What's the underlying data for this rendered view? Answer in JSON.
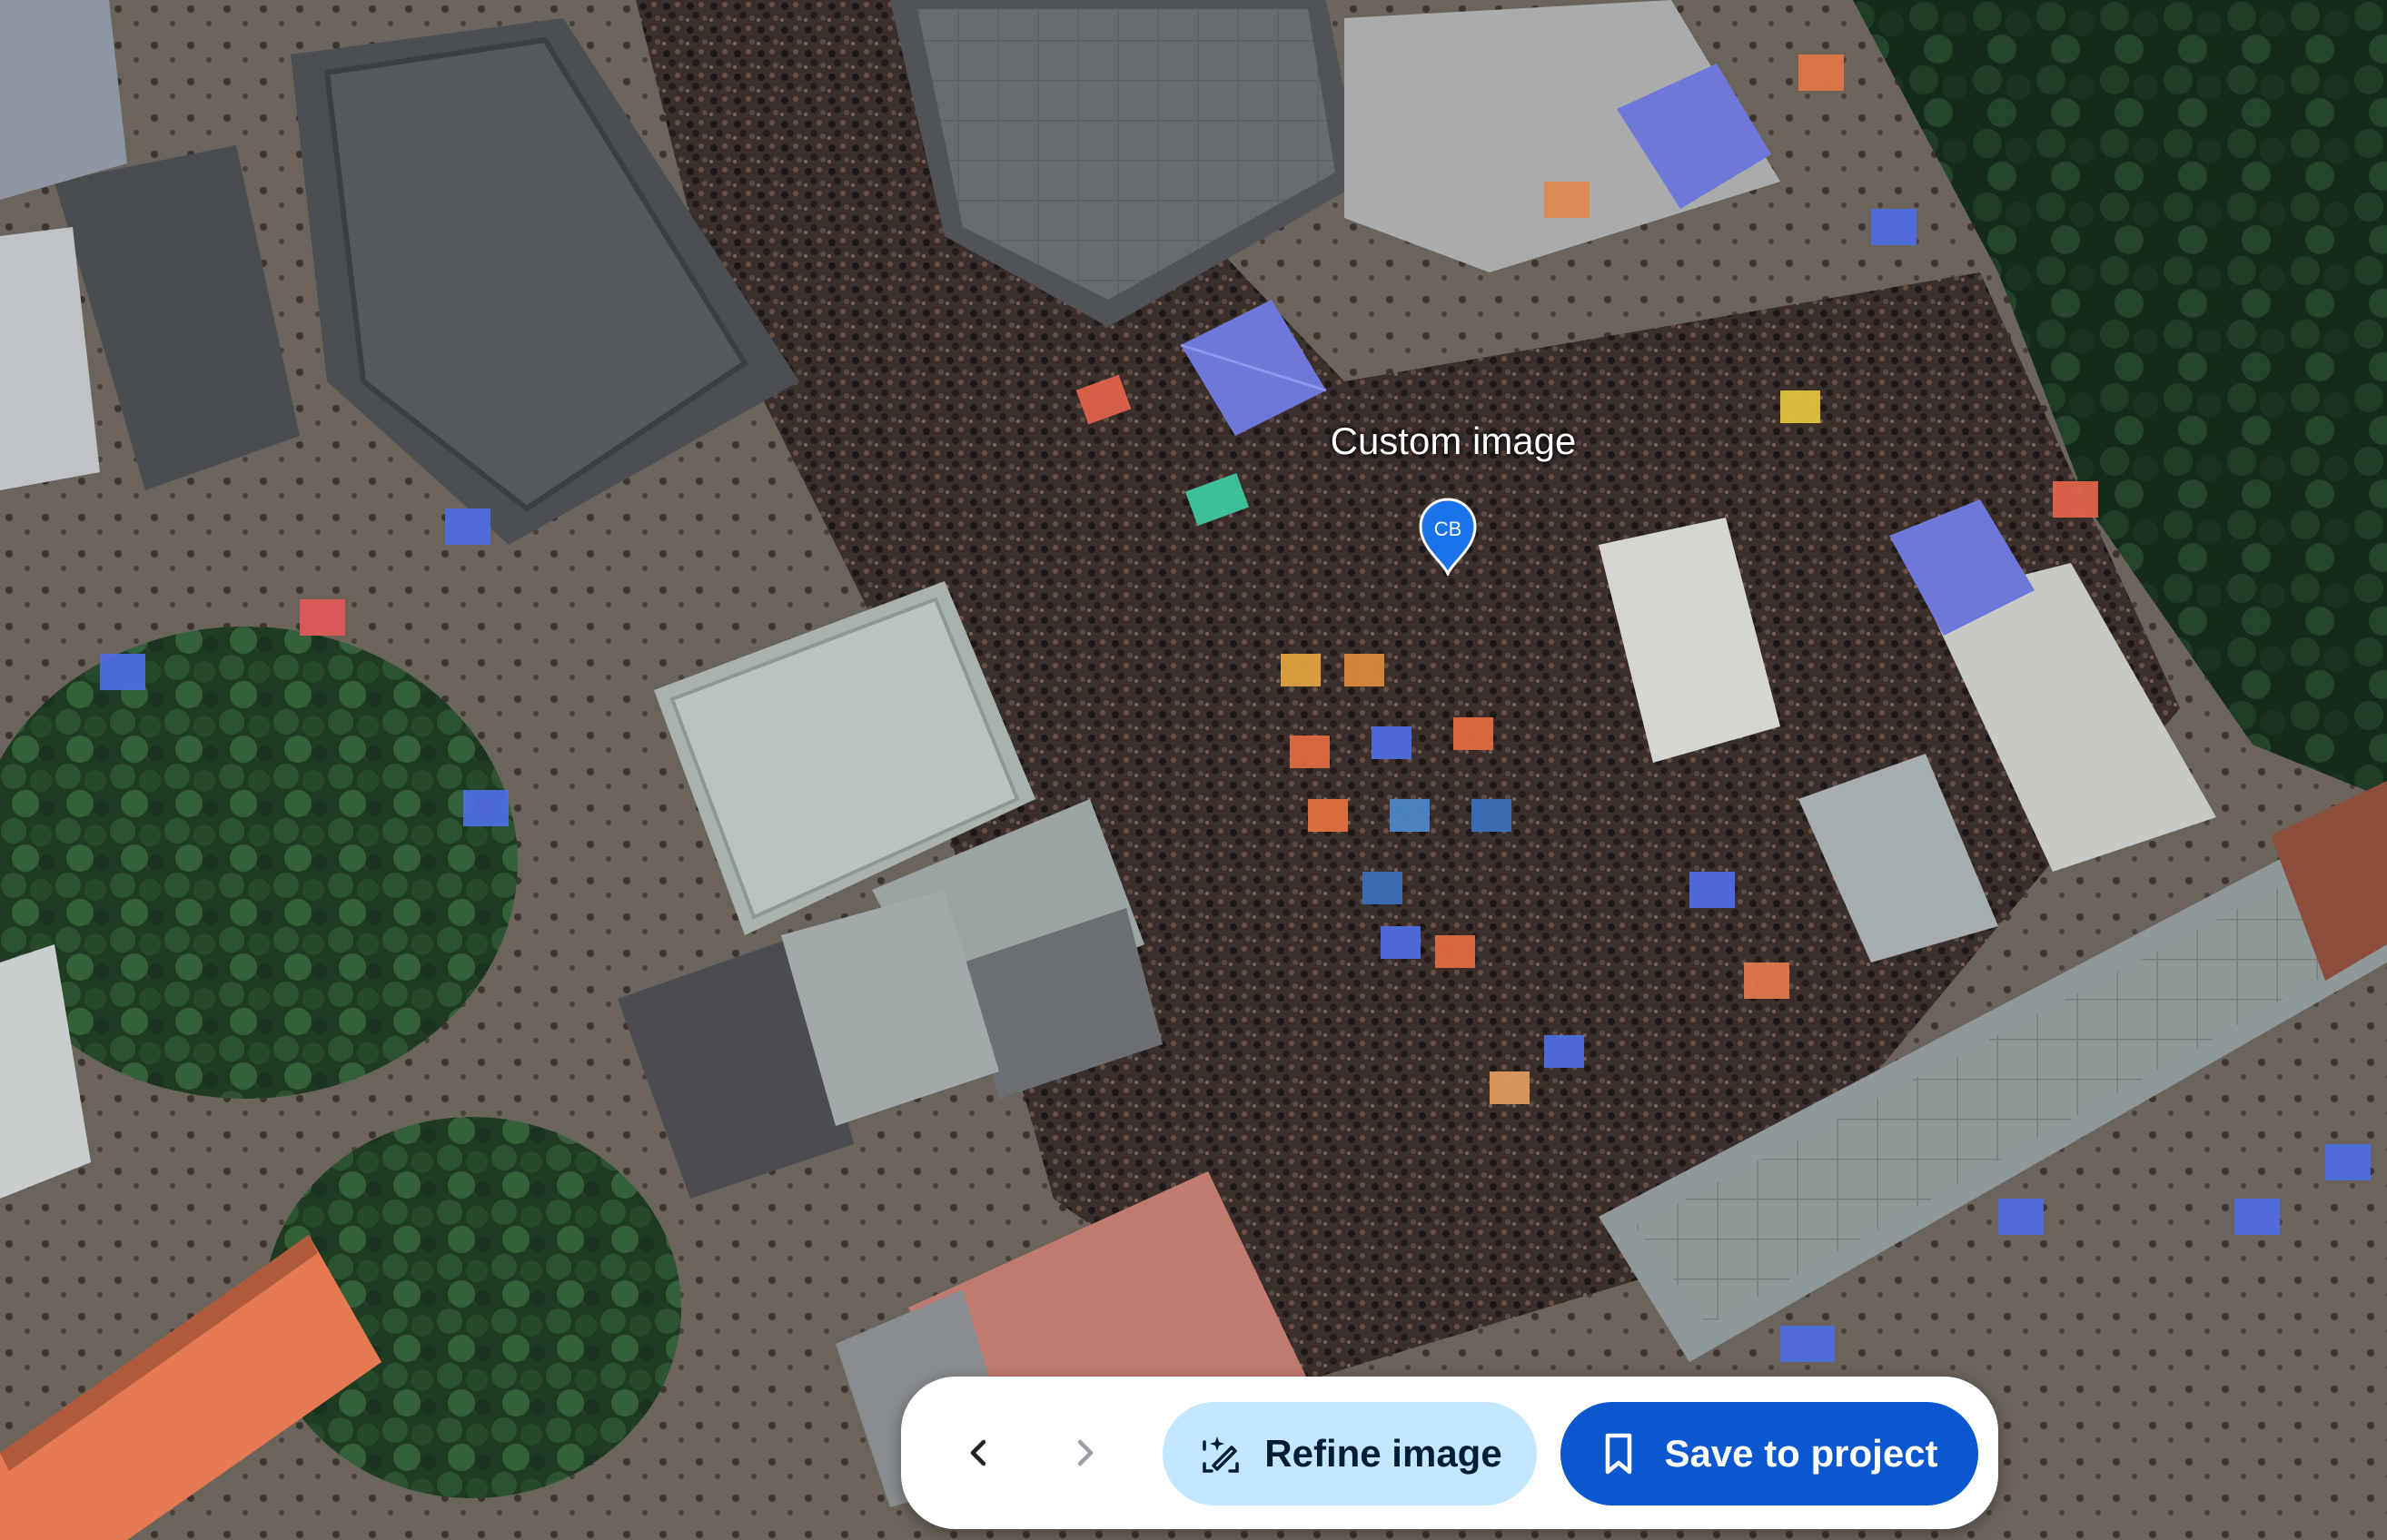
{
  "map": {
    "marker_label": "Custom image",
    "marker_initials": "CB"
  },
  "toolbar": {
    "prev_icon": "chevron-left-icon",
    "next_icon": "chevron-right-icon",
    "refine_label": "Refine image",
    "refine_icon": "sparkle-edit-icon",
    "save_label": "Save to project",
    "save_icon": "bookmark-icon"
  },
  "colors": {
    "refine_bg": "#c2e7ff",
    "save_bg": "#0b57d0",
    "pin": "#1a73e8"
  }
}
